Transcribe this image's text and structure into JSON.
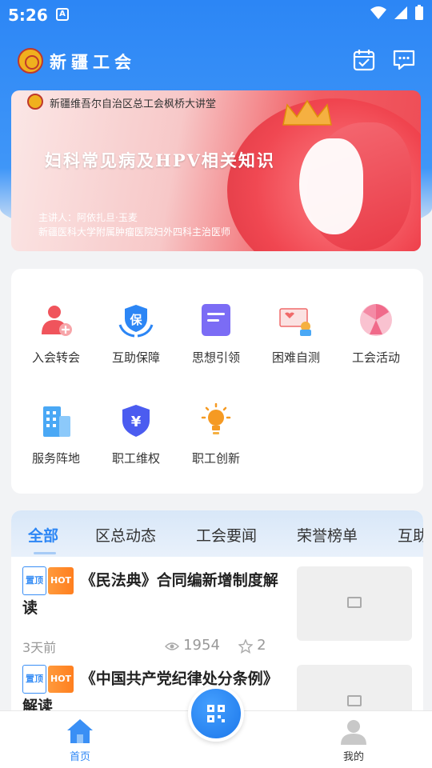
{
  "status": {
    "time": "5:26"
  },
  "header": {
    "title": "新疆工会"
  },
  "banner": {
    "org": "新疆维吾尔自治区总工会枫桥大讲堂",
    "headline": "妇科常见病及HPV相关知识",
    "speaker": "主讲人：阿依扎旦·玉麦",
    "speaker_title": "新疆医科大学附属肿瘤医院妇外四科主治医师"
  },
  "services": [
    {
      "label": "入会转会",
      "icon": "user-add-icon",
      "color": "#f0545c"
    },
    {
      "label": "互助保障",
      "icon": "shield-hands-icon",
      "color": "#2c86f5"
    },
    {
      "label": "思想引领",
      "icon": "document-icon",
      "color": "#7b6cf5"
    },
    {
      "label": "困难自测",
      "icon": "assessment-icon",
      "color": "#f06a6a"
    },
    {
      "label": "工会活动",
      "icon": "fan-icon",
      "color": "#f06a8a"
    },
    {
      "label": "服务阵地",
      "icon": "building-icon",
      "color": "#4aa8f5"
    },
    {
      "label": "职工维权",
      "icon": "yuan-shield-icon",
      "color": "#4b5cf0"
    },
    {
      "label": "职工创新",
      "icon": "lightbulb-icon",
      "color": "#f59a23"
    }
  ],
  "tabs": [
    "全部",
    "区总动态",
    "工会要闻",
    "荣誉榜单",
    "互助"
  ],
  "news": [
    {
      "badge_top": "置顶",
      "badge_hot": "HOT",
      "title": "《民法典》合同编新增制度解读",
      "time": "3天前",
      "views": "1954",
      "stars": "2"
    },
    {
      "badge_top": "置顶",
      "badge_hot": "HOT",
      "title": "《中国共产党纪律处分条例》解读",
      "time": "",
      "views": "",
      "stars": ""
    }
  ],
  "bottom_nav": {
    "home": "首页",
    "mine": "我的"
  },
  "colors": {
    "primary": "#2c86f5",
    "hot": "#ff8a2a"
  }
}
